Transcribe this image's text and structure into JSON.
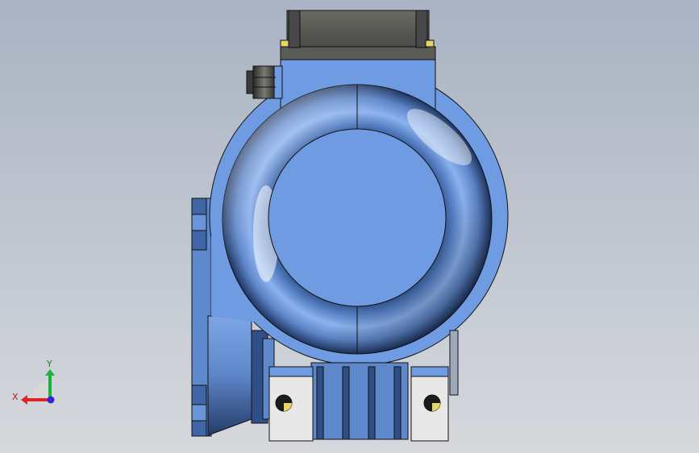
{
  "viewport": {
    "background_top": "#a9b3c3",
    "background_bottom": "#d6d8dc"
  },
  "model": {
    "body_color": "#6f9be3",
    "body_shadow": "#2f4f86",
    "terminal_box_color": "#5c5c58",
    "bracket_color": "#e8e8e8",
    "outline_color": "#111111"
  },
  "triad": {
    "x_label": "X",
    "y_label": "Y",
    "x_color": "#e0222a",
    "y_color": "#1cb33a",
    "z_color": "#2a2ad8"
  }
}
